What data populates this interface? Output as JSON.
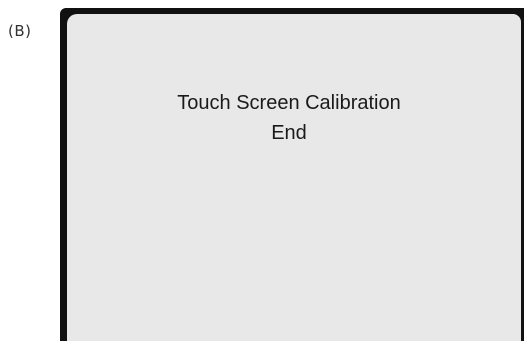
{
  "figure": {
    "panel_label": "(B)"
  },
  "screen": {
    "title": "Touch Screen Calibration",
    "status": "End",
    "background_color": "#e8e8e8",
    "frame_color": "#111111"
  }
}
